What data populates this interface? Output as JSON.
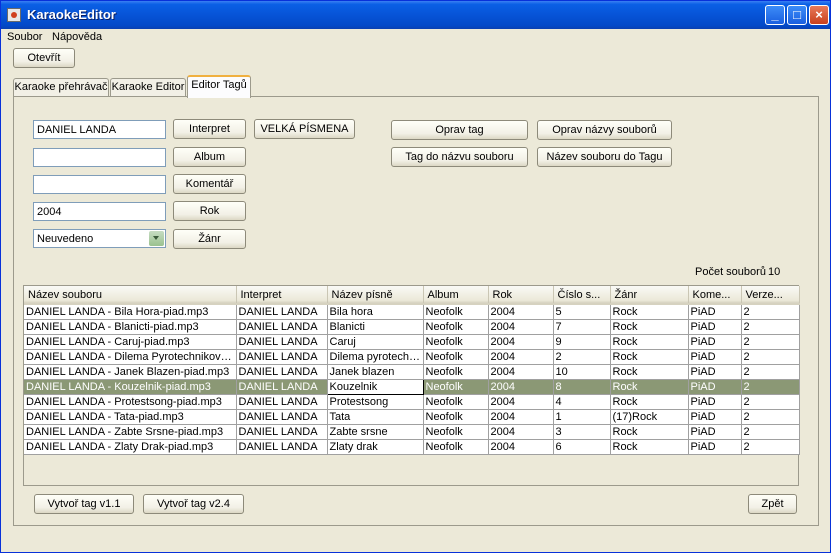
{
  "window": {
    "title": "KaraokeEditor"
  },
  "menu": {
    "items": [
      "Soubor",
      "Nápověda"
    ]
  },
  "toolbar": {
    "open_label": "Otevřít"
  },
  "tabs": [
    {
      "label": "Karaoke přehrávač"
    },
    {
      "label": "Karaoke Editor"
    },
    {
      "label": "Editor Tagů"
    }
  ],
  "form": {
    "interpret_value": "DANIEL LANDA",
    "interpret_button": "Interpret",
    "uppercase_button": "VELKÁ PÍSMENA",
    "album_value": "",
    "album_button": "Album",
    "comment_value": "",
    "comment_button": "Komentář",
    "year_value": "2004",
    "year_button": "Rok",
    "genre_value": "Neuvedeno",
    "genre_button": "Žánr"
  },
  "actions": {
    "fix_tag": "Oprav tag",
    "fix_filenames": "Oprav názvy souborů",
    "tag_to_filename": "Tag do názvu souboru",
    "filename_to_tag": "Název souboru do Tagu"
  },
  "file_count": {
    "label": "Počet souborů",
    "value": "10"
  },
  "table": {
    "columns": [
      "Název souboru",
      "Interpret",
      "Název písně",
      "Album",
      "Rok",
      "Číslo s...",
      "Žánr",
      "Kome...",
      "Verze..."
    ],
    "rows": [
      [
        "DANIEL LANDA - Bila Hora-piad.mp3",
        "DANIEL LANDA",
        "Bila hora",
        "Neofolk",
        "2004",
        "5",
        "Rock",
        "PiAD",
        "2"
      ],
      [
        "DANIEL LANDA - Blanicti-piad.mp3",
        "DANIEL LANDA",
        "Blanicti",
        "Neofolk",
        "2004",
        "7",
        "Rock",
        "PiAD",
        "2"
      ],
      [
        "DANIEL LANDA - Caruj-piad.mp3",
        "DANIEL LANDA",
        "Caruj",
        "Neofolk",
        "2004",
        "9",
        "Rock",
        "PiAD",
        "2"
      ],
      [
        "DANIEL LANDA - Dilema Pyrotechnikovo-pia...",
        "DANIEL LANDA",
        "Dilema pyrotechni...",
        "Neofolk",
        "2004",
        "2",
        "Rock",
        "PiAD",
        "2"
      ],
      [
        "DANIEL LANDA - Janek Blazen-piad.mp3",
        "DANIEL LANDA",
        "Janek blazen",
        "Neofolk",
        "2004",
        "10",
        "Rock",
        "PiAD",
        "2"
      ],
      [
        "DANIEL LANDA - Kouzelnik-piad.mp3",
        "DANIEL LANDA",
        "Kouzelnik",
        "Neofolk",
        "2004",
        "8",
        "Rock",
        "PiAD",
        "2"
      ],
      [
        "DANIEL LANDA - Protestsong-piad.mp3",
        "DANIEL LANDA",
        "Protestsong",
        "Neofolk",
        "2004",
        "4",
        "Rock",
        "PiAD",
        "2"
      ],
      [
        "DANIEL LANDA - Tata-piad.mp3",
        "DANIEL LANDA",
        "Tata",
        "Neofolk",
        "2004",
        "1",
        "(17)Rock",
        "PiAD",
        "2"
      ],
      [
        "DANIEL LANDA - Zabte Srsne-piad.mp3",
        "DANIEL LANDA",
        "Zabte srsne",
        "Neofolk",
        "2004",
        "3",
        "Rock",
        "PiAD",
        "2"
      ],
      [
        "DANIEL LANDA - Zlaty Drak-piad.mp3",
        "DANIEL LANDA",
        "Zlaty drak",
        "Neofolk",
        "2004",
        "6",
        "Rock",
        "PiAD",
        "2"
      ]
    ]
  },
  "bottom": {
    "create_v11": "Vytvoř tag v1.1",
    "create_v24": "Vytvoř tag v2.4",
    "back": "Zpět"
  }
}
